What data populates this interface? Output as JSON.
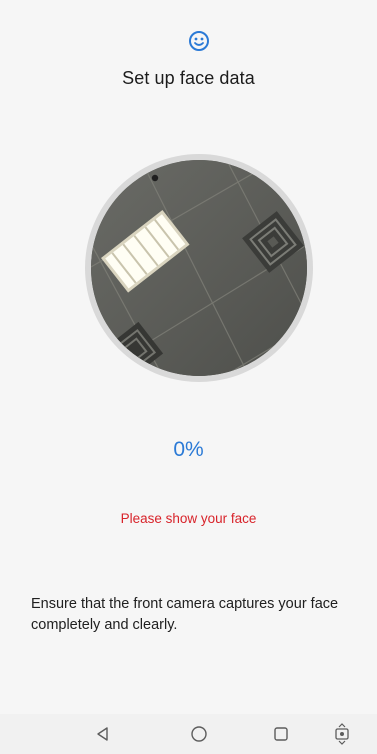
{
  "header": {
    "icon": "smiley-face-icon",
    "title": "Set up face data"
  },
  "camera": {
    "preview": "camera-preview",
    "ring_color": "#d9d9d9"
  },
  "progress": {
    "text": "0%",
    "value": 0,
    "color": "#2b7ad6"
  },
  "status": {
    "text": "Please show your face",
    "color": "#d8232a"
  },
  "instruction": {
    "text": "Ensure that the front camera captures your face completely and clearly."
  },
  "navbar": {
    "buttons": [
      "back-icon",
      "home-icon",
      "recents-icon",
      "screenshot-icon"
    ]
  }
}
